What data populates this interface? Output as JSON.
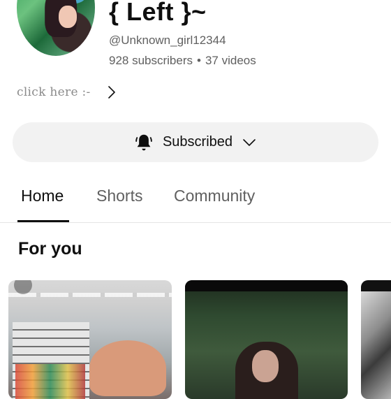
{
  "channel": {
    "name": "{ Left }~",
    "handle": "@Unknown_girl12344",
    "subscribers": "928 subscribers",
    "separator": "•",
    "videos": "37 videos",
    "link_text": "click here :-"
  },
  "subscribe": {
    "label": "Subscribed",
    "bell_icon": "bell-icon",
    "chevron_icon": "chevron-down-icon"
  },
  "tabs": [
    {
      "label": "Home",
      "active": true
    },
    {
      "label": "Shorts",
      "active": false
    },
    {
      "label": "Community",
      "active": false
    }
  ],
  "section": {
    "title": "For you"
  },
  "colors": {
    "primary_text": "#0f0f0f",
    "secondary_text": "#606060",
    "button_bg": "#f2f2f2",
    "divider": "#e5e5e5"
  }
}
